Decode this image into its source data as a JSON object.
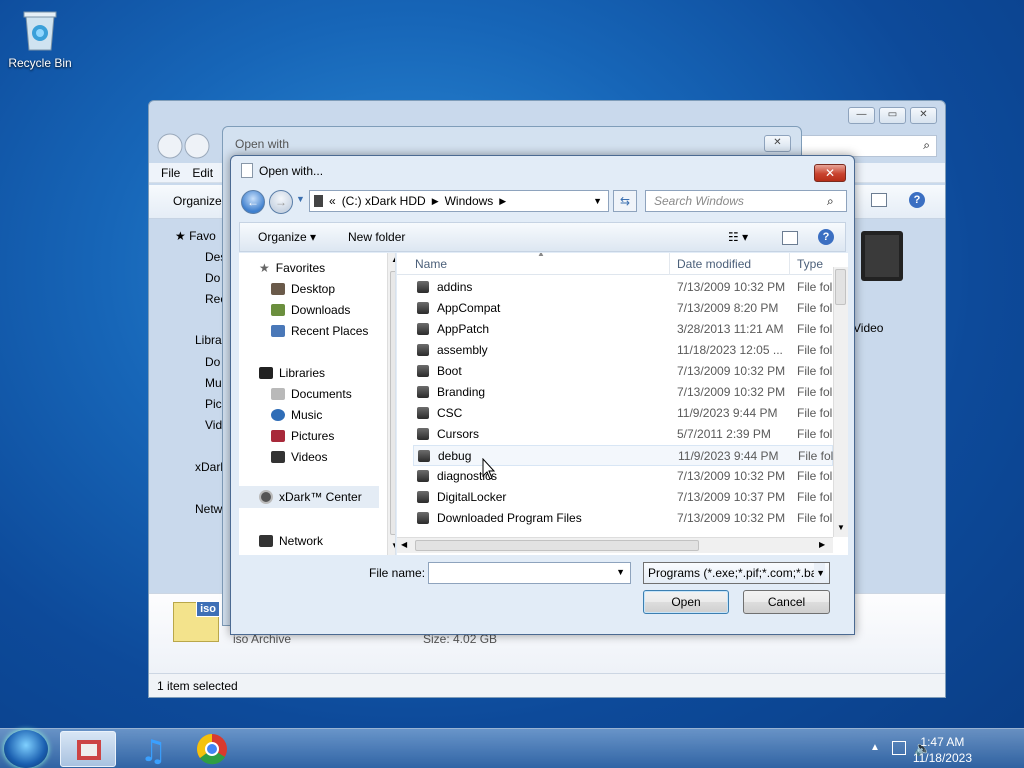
{
  "desktop": {
    "recycle_bin_label": "Recycle Bin"
  },
  "explorer": {
    "menu": [
      "File",
      "Edit"
    ],
    "organize_label": "Organize",
    "nav_items": [
      "Favo",
      "Des",
      "Do",
      "Rec",
      "Libra",
      "Do",
      "Mu",
      "Pic",
      "Vid",
      "xDark",
      "Netw"
    ],
    "right_icon_label": "Video",
    "details": {
      "type_label": "iso Archive",
      "size_label": "Size: 4.02 GB",
      "iso_badge": "iso"
    },
    "status": "1 item selected"
  },
  "openwith_window": {
    "title": "Open with"
  },
  "dialog": {
    "title": "Open with...",
    "address": {
      "chevron": "«",
      "segments": [
        "(C:) xDark HDD",
        "Windows"
      ]
    },
    "search_placeholder": "Search Windows",
    "toolbar": {
      "organize": "Organize",
      "new_folder": "New folder"
    },
    "nav": {
      "favorites": "Favorites",
      "favorites_items": [
        "Desktop",
        "Downloads",
        "Recent Places"
      ],
      "libraries": "Libraries",
      "libraries_items": [
        "Documents",
        "Music",
        "Pictures",
        "Videos"
      ],
      "xdark": "xDark™ Center",
      "network": "Network"
    },
    "columns": {
      "name": "Name",
      "date": "Date modified",
      "type": "Type"
    },
    "files": [
      {
        "name": "addins",
        "date": "7/13/2009 10:32 PM",
        "type": "File fol"
      },
      {
        "name": "AppCompat",
        "date": "7/13/2009 8:20 PM",
        "type": "File fol"
      },
      {
        "name": "AppPatch",
        "date": "3/28/2013 11:21 AM",
        "type": "File fol"
      },
      {
        "name": "assembly",
        "date": "11/18/2023 12:05 ...",
        "type": "File fol"
      },
      {
        "name": "Boot",
        "date": "7/13/2009 10:32 PM",
        "type": "File fol"
      },
      {
        "name": "Branding",
        "date": "7/13/2009 10:32 PM",
        "type": "File fol"
      },
      {
        "name": "CSC",
        "date": "11/9/2023 9:44 PM",
        "type": "File fol"
      },
      {
        "name": "Cursors",
        "date": "5/7/2011 2:39 PM",
        "type": "File fol"
      },
      {
        "name": "debug",
        "date": "11/9/2023 9:44 PM",
        "type": "File fol"
      },
      {
        "name": "diagnostics",
        "date": "7/13/2009 10:32 PM",
        "type": "File fol"
      },
      {
        "name": "DigitalLocker",
        "date": "7/13/2009 10:37 PM",
        "type": "File fol"
      },
      {
        "name": "Downloaded Program Files",
        "date": "7/13/2009 10:32 PM",
        "type": "File fol"
      }
    ],
    "file_name_label": "File name:",
    "file_name_value": "",
    "file_type": "Programs (*.exe;*.pif;*.com;*.ba",
    "open_label": "Open",
    "cancel_label": "Cancel"
  },
  "taskbar": {
    "time": "1:47 AM",
    "date": "11/18/2023"
  }
}
